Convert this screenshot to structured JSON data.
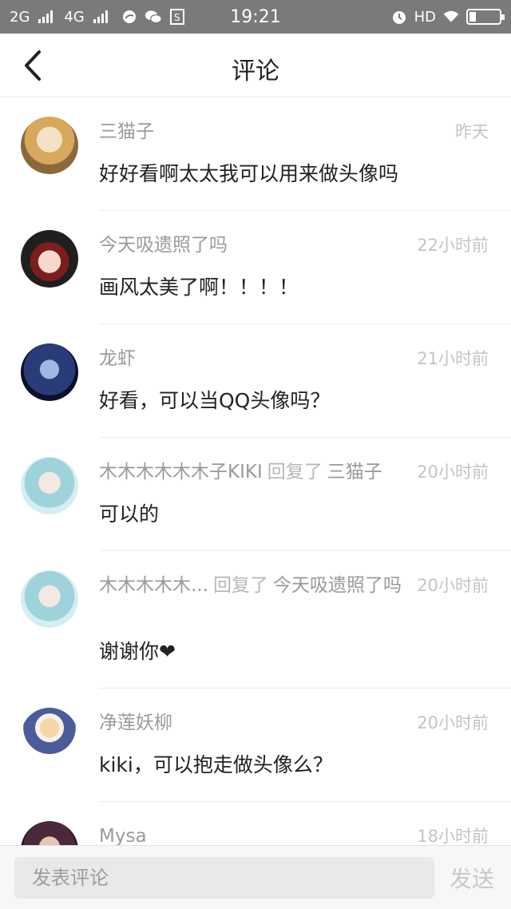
{
  "status_bar": {
    "sim1": "2G",
    "sim2": "4G",
    "time": "19:21",
    "hd": "HD",
    "icons": [
      "signal-icon",
      "chat-bubble-icon",
      "wechat-icon",
      "sim-s-icon",
      "alarm-icon",
      "wifi-icon",
      "battery-icon"
    ]
  },
  "header": {
    "title": "评论",
    "back_icon": "chevron-left-icon"
  },
  "comments": [
    {
      "author": "三猫子",
      "time": "昨天",
      "text": "好好看啊太太我可以用来做头像吗"
    },
    {
      "author": "今天吸遗照了吗",
      "time": "22小时前",
      "text": "画风太美了啊！！！！"
    },
    {
      "author": "龙虾",
      "time": "21小时前",
      "text": "好看，可以当QQ头像吗？"
    },
    {
      "author": "木木木木木木子KIKI",
      "reply_word": "回复了",
      "reply_target": "三猫子",
      "time": "20小时前",
      "text": "可以的"
    },
    {
      "author": "木木木木木...",
      "reply_word": "回复了",
      "reply_target": "今天吸遗照了吗",
      "time": "20小时前",
      "text": "谢谢你❤"
    },
    {
      "author": "净莲妖柳",
      "time": "20小时前",
      "text": "kiki，可以抱走做头像么？"
    },
    {
      "author": "Mysa",
      "time": "18小时前",
      "text": ""
    }
  ],
  "composer": {
    "placeholder": "发表评论",
    "send_label": "发送"
  }
}
